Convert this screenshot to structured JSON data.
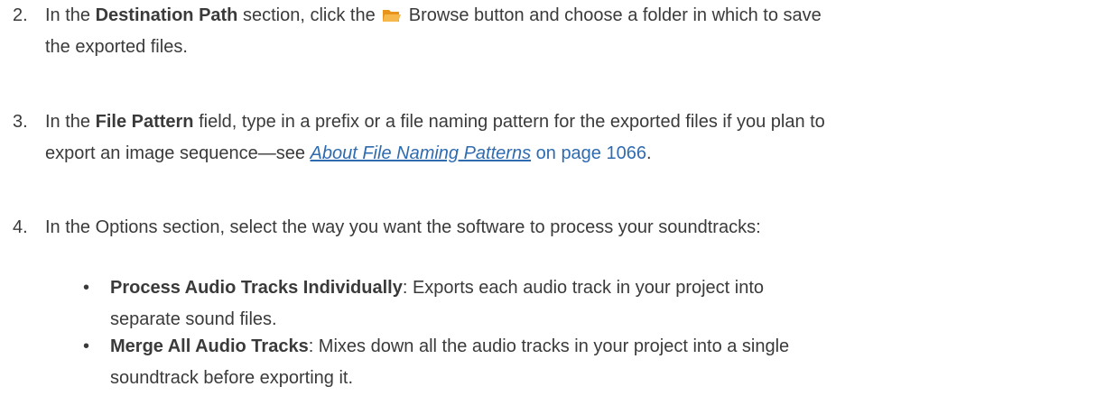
{
  "steps": [
    {
      "number": "2.",
      "pre": "In the ",
      "bold": "Destination Path",
      "mid": " section, click the ",
      "post": " Browse button and choose a folder in which to save",
      "line2": "the exported files."
    },
    {
      "number": "3.",
      "pre": "In the ",
      "bold": "File Pattern",
      "post": " field, type in a prefix or a file naming pattern for the exported files if you plan to",
      "line2_pre": "export an image sequence—see ",
      "link": "About File Naming Patterns",
      "page_ref": " on page 1066",
      "line2_post": "."
    },
    {
      "number": "4.",
      "text": "In the Options section, select the way you want the software to process your soundtracks:"
    }
  ],
  "bullets": [
    {
      "bold": "Process Audio Tracks Individually",
      "text": ": Exports each audio track in your project into",
      "line2": "separate sound files."
    },
    {
      "bold": "Merge All Audio Tracks",
      "text": ": Mixes down all the audio tracks in your project into a single",
      "line2": "soundtrack before exporting it."
    }
  ],
  "icons": {
    "browse": "folder-open-icon"
  },
  "colors": {
    "text": "#3a3a3a",
    "link": "#2e6bb0",
    "folder": "#f5a623"
  }
}
